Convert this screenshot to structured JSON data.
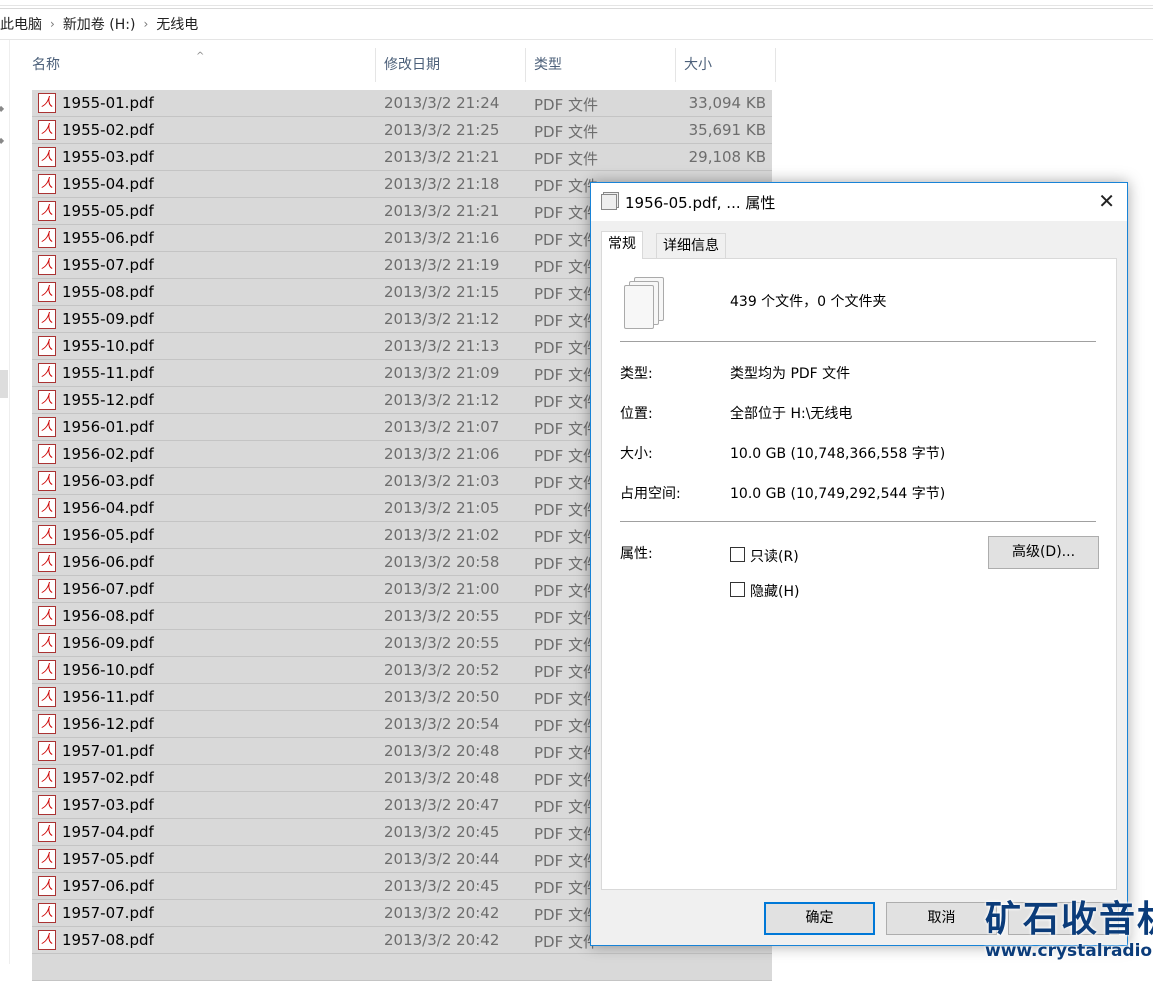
{
  "breadcrumb": [
    "此电脑",
    "新加卷 (H:)",
    "无线电"
  ],
  "columns": {
    "name": "名称",
    "date": "修改日期",
    "type": "类型",
    "size": "大小"
  },
  "files": [
    {
      "name": "1955-01.pdf",
      "date": "2013/3/2 21:24",
      "type": "PDF 文件",
      "size": "33,094 KB"
    },
    {
      "name": "1955-02.pdf",
      "date": "2013/3/2 21:25",
      "type": "PDF 文件",
      "size": "35,691 KB"
    },
    {
      "name": "1955-03.pdf",
      "date": "2013/3/2 21:21",
      "type": "PDF 文件",
      "size": "29,108 KB"
    },
    {
      "name": "1955-04.pdf",
      "date": "2013/3/2 21:18",
      "type": "PDF 文件"
    },
    {
      "name": "1955-05.pdf",
      "date": "2013/3/2 21:21",
      "type": "PDF 文件"
    },
    {
      "name": "1955-06.pdf",
      "date": "2013/3/2 21:16",
      "type": "PDF 文件"
    },
    {
      "name": "1955-07.pdf",
      "date": "2013/3/2 21:19",
      "type": "PDF 文件"
    },
    {
      "name": "1955-08.pdf",
      "date": "2013/3/2 21:15",
      "type": "PDF 文件"
    },
    {
      "name": "1955-09.pdf",
      "date": "2013/3/2 21:12",
      "type": "PDF 文件"
    },
    {
      "name": "1955-10.pdf",
      "date": "2013/3/2 21:13",
      "type": "PDF 文件"
    },
    {
      "name": "1955-11.pdf",
      "date": "2013/3/2 21:09",
      "type": "PDF 文件"
    },
    {
      "name": "1955-12.pdf",
      "date": "2013/3/2 21:12",
      "type": "PDF 文件"
    },
    {
      "name": "1956-01.pdf",
      "date": "2013/3/2 21:07",
      "type": "PDF 文件"
    },
    {
      "name": "1956-02.pdf",
      "date": "2013/3/2 21:06",
      "type": "PDF 文件"
    },
    {
      "name": "1956-03.pdf",
      "date": "2013/3/2 21:03",
      "type": "PDF 文件"
    },
    {
      "name": "1956-04.pdf",
      "date": "2013/3/2 21:05",
      "type": "PDF 文件"
    },
    {
      "name": "1956-05.pdf",
      "date": "2013/3/2 21:02",
      "type": "PDF 文件"
    },
    {
      "name": "1956-06.pdf",
      "date": "2013/3/2 20:58",
      "type": "PDF 文件"
    },
    {
      "name": "1956-07.pdf",
      "date": "2013/3/2 21:00",
      "type": "PDF 文件"
    },
    {
      "name": "1956-08.pdf",
      "date": "2013/3/2 20:55",
      "type": "PDF 文件"
    },
    {
      "name": "1956-09.pdf",
      "date": "2013/3/2 20:55",
      "type": "PDF 文件"
    },
    {
      "name": "1956-10.pdf",
      "date": "2013/3/2 20:52",
      "type": "PDF 文件"
    },
    {
      "name": "1956-11.pdf",
      "date": "2013/3/2 20:50",
      "type": "PDF 文件"
    },
    {
      "name": "1956-12.pdf",
      "date": "2013/3/2 20:54",
      "type": "PDF 文件"
    },
    {
      "name": "1957-01.pdf",
      "date": "2013/3/2 20:48",
      "type": "PDF 文件"
    },
    {
      "name": "1957-02.pdf",
      "date": "2013/3/2 20:48",
      "type": "PDF 文件"
    },
    {
      "name": "1957-03.pdf",
      "date": "2013/3/2 20:47",
      "type": "PDF 文件"
    },
    {
      "name": "1957-04.pdf",
      "date": "2013/3/2 20:45",
      "type": "PDF 文件"
    },
    {
      "name": "1957-05.pdf",
      "date": "2013/3/2 20:44",
      "type": "PDF 文件"
    },
    {
      "name": "1957-06.pdf",
      "date": "2013/3/2 20:45",
      "type": "PDF 文件"
    },
    {
      "name": "1957-07.pdf",
      "date": "2013/3/2 20:42",
      "type": "PDF 文件"
    },
    {
      "name": "1957-08.pdf",
      "date": "2013/3/2 20:42",
      "type": "PDF 文件"
    }
  ],
  "dialog": {
    "title": "1956-05.pdf, ... 属性",
    "tabs": [
      "常规",
      "详细信息"
    ],
    "summary": "439 个文件，0 个文件夹",
    "type_label": "类型:",
    "type_value": "类型均为 PDF 文件",
    "location_label": "位置:",
    "location_value": "全部位于 H:\\无线电",
    "size_label": "大小:",
    "size_value": "10.0 GB (10,748,366,558 字节)",
    "disk_label": "占用空间:",
    "disk_value": "10.0 GB (10,749,292,544 字节)",
    "attr_label": "属性:",
    "readonly": "只读(R)",
    "hidden": "隐藏(H)",
    "advanced": "高级(D)...",
    "ok": "确定",
    "cancel": "取消"
  },
  "watermark": {
    "title": "矿石收音机",
    "url": "www.crystalradio.cn"
  }
}
